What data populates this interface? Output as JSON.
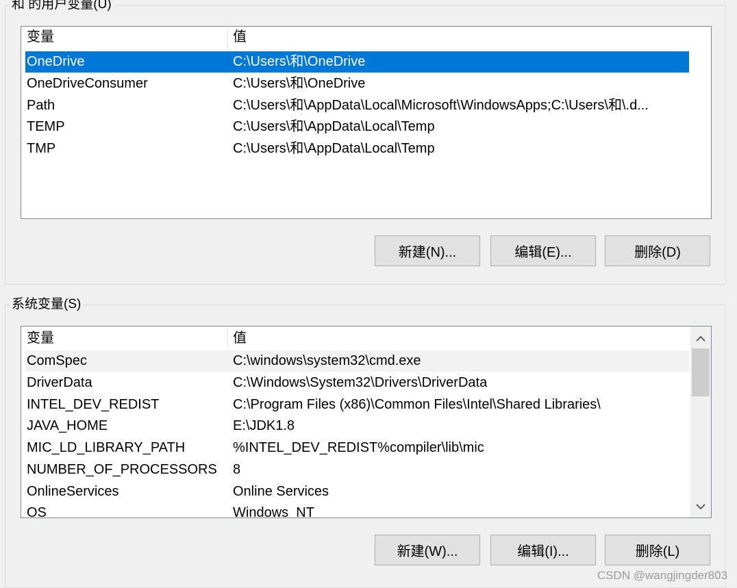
{
  "user_vars": {
    "title": "和 的用户变量(U)",
    "headers": [
      "变量",
      "值"
    ],
    "rows": [
      {
        "name": "OneDrive",
        "value": "C:\\Users\\和\\OneDrive"
      },
      {
        "name": "OneDriveConsumer",
        "value": "C:\\Users\\和\\OneDrive"
      },
      {
        "name": "Path",
        "value": "C:\\Users\\和\\AppData\\Local\\Microsoft\\WindowsApps;C:\\Users\\和\\.d..."
      },
      {
        "name": "TEMP",
        "value": "C:\\Users\\和\\AppData\\Local\\Temp"
      },
      {
        "name": "TMP",
        "value": "C:\\Users\\和\\AppData\\Local\\Temp"
      }
    ],
    "selected_index": 0,
    "buttons": {
      "new": "新建(N)...",
      "edit": "编辑(E)...",
      "delete": "删除(D)"
    }
  },
  "system_vars": {
    "title": "系统变量(S)",
    "headers": [
      "变量",
      "值"
    ],
    "rows": [
      {
        "name": "ComSpec",
        "value": "C:\\windows\\system32\\cmd.exe"
      },
      {
        "name": "DriverData",
        "value": "C:\\Windows\\System32\\Drivers\\DriverData"
      },
      {
        "name": "INTEL_DEV_REDIST",
        "value": "C:\\Program Files (x86)\\Common Files\\Intel\\Shared Libraries\\"
      },
      {
        "name": "JAVA_HOME",
        "value": "E:\\JDK1.8"
      },
      {
        "name": "MIC_LD_LIBRARY_PATH",
        "value": "%INTEL_DEV_REDIST%compiler\\lib\\mic"
      },
      {
        "name": "NUMBER_OF_PROCESSORS",
        "value": "8"
      },
      {
        "name": "OnlineServices",
        "value": "Online Services"
      },
      {
        "name": "OS",
        "value": "Windows_NT"
      }
    ],
    "buttons": {
      "new": "新建(W)...",
      "edit": "编辑(I)...",
      "delete": "删除(L)"
    }
  },
  "watermark": "CSDN @wangjingder803",
  "colors": {
    "selection": "#0078d7",
    "hover": "#e5f3ff"
  }
}
